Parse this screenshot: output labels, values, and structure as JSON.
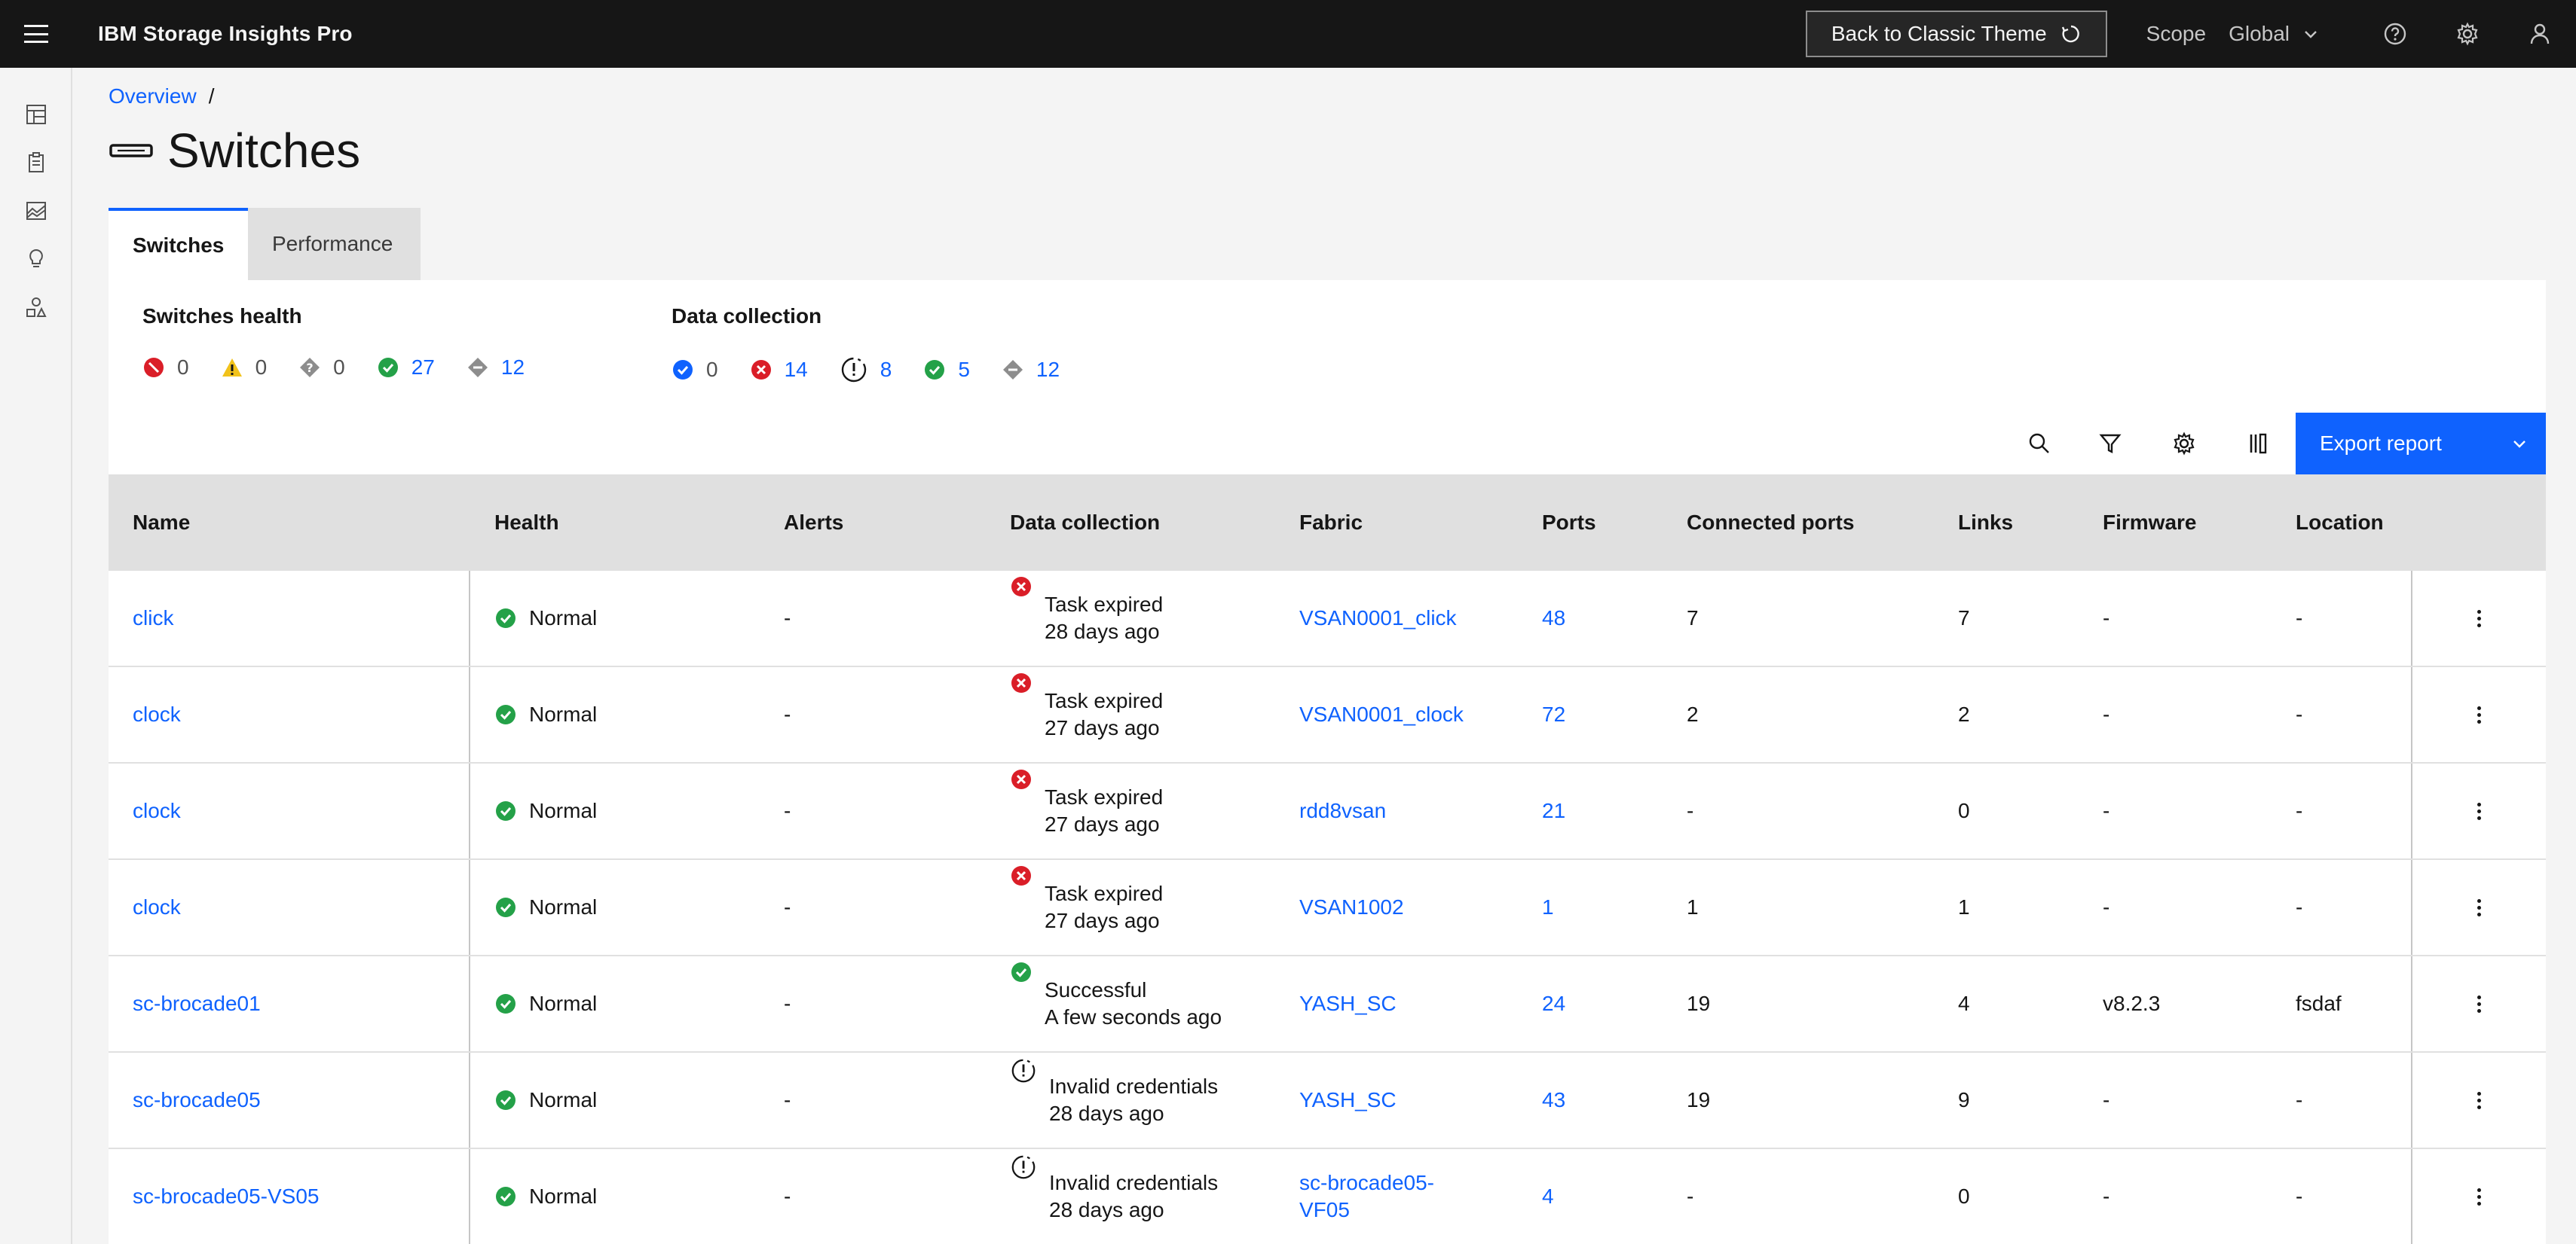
{
  "app": {
    "title": "IBM Storage Insights Pro",
    "classic_button": "Back to Classic Theme",
    "scope_label": "Scope",
    "scope_value": "Global"
  },
  "breadcrumb": {
    "overview": "Overview",
    "separator": "/"
  },
  "page": {
    "title": "Switches"
  },
  "tabs": [
    {
      "label": "Switches",
      "active": true
    },
    {
      "label": "Performance",
      "active": false
    }
  ],
  "summary": {
    "health": {
      "title": "Switches health",
      "counts": [
        {
          "icon": "error-icon",
          "value": "0"
        },
        {
          "icon": "warning-icon",
          "value": "0"
        },
        {
          "icon": "unknown-icon",
          "value": "0"
        },
        {
          "icon": "normal-icon",
          "value": "27"
        },
        {
          "icon": "unreachable-icon",
          "value": "12"
        }
      ]
    },
    "data_collection": {
      "title": "Data collection",
      "counts": [
        {
          "icon": "running-icon",
          "value": "0"
        },
        {
          "icon": "failed-icon",
          "value": "14"
        },
        {
          "icon": "warning-clock-icon",
          "value": "8"
        },
        {
          "icon": "success-icon",
          "value": "5"
        },
        {
          "icon": "unknown-icon",
          "value": "12"
        }
      ]
    }
  },
  "toolbar": {
    "export_label": "Export report"
  },
  "table": {
    "columns": [
      "Name",
      "Health",
      "Alerts",
      "Data collection",
      "Fabric",
      "Ports",
      "Connected ports",
      "Links",
      "Firmware",
      "Location"
    ],
    "rows": [
      {
        "name": "click",
        "health": "Normal",
        "alerts": "-",
        "dc_status": "Task expired",
        "dc_time": "28 days ago",
        "dc_type": "error",
        "fabric": "VSAN0001_click",
        "ports": "48",
        "connected": "7",
        "links": "7",
        "firmware": "-",
        "location": "-"
      },
      {
        "name": "clock",
        "health": "Normal",
        "alerts": "-",
        "dc_status": "Task expired",
        "dc_time": "27 days ago",
        "dc_type": "error",
        "fabric": "VSAN0001_clock",
        "ports": "72",
        "connected": "2",
        "links": "2",
        "firmware": "-",
        "location": "-"
      },
      {
        "name": "clock",
        "health": "Normal",
        "alerts": "-",
        "dc_status": "Task expired",
        "dc_time": "27 days ago",
        "dc_type": "error",
        "fabric": "rdd8vsan",
        "ports": "21",
        "connected": "-",
        "links": "0",
        "firmware": "-",
        "location": "-"
      },
      {
        "name": "clock",
        "health": "Normal",
        "alerts": "-",
        "dc_status": "Task expired",
        "dc_time": "27 days ago",
        "dc_type": "error",
        "fabric": "VSAN1002",
        "ports": "1",
        "connected": "1",
        "links": "1",
        "firmware": "-",
        "location": "-"
      },
      {
        "name": "sc-brocade01",
        "health": "Normal",
        "alerts": "-",
        "dc_status": "Successful",
        "dc_time": "A few seconds ago",
        "dc_type": "success",
        "fabric": "YASH_SC",
        "ports": "24",
        "connected": "19",
        "links": "4",
        "firmware": "v8.2.3",
        "location": "fsdaf"
      },
      {
        "name": "sc-brocade05",
        "health": "Normal",
        "alerts": "-",
        "dc_status": "Invalid credentials",
        "dc_time": "28 days ago",
        "dc_type": "warning",
        "fabric": "YASH_SC",
        "ports": "43",
        "connected": "19",
        "links": "9",
        "firmware": "-",
        "location": "-"
      },
      {
        "name": "sc-brocade05-VS05",
        "health": "Normal",
        "alerts": "-",
        "dc_status": "Invalid credentials",
        "dc_time": "28 days ago",
        "dc_type": "warning",
        "fabric": "sc-brocade05-VF05",
        "ports": "4",
        "connected": "-",
        "links": "0",
        "firmware": "-",
        "location": "-"
      }
    ]
  },
  "colors": {
    "primary": "#0f62fe",
    "error": "#da1e28",
    "success": "#24a148",
    "warning": "#f1c21b",
    "header_bg": "#161616"
  }
}
